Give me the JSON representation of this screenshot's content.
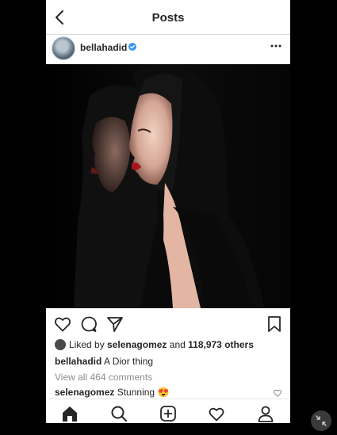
{
  "header": {
    "title": "Posts"
  },
  "post": {
    "username": "bellahadid",
    "likes": {
      "prefix": "Liked by",
      "user": "selenagomez",
      "joiner": "and",
      "count": "118,973 others"
    },
    "caption": {
      "user": "bellahadid",
      "text": "A Dior thing"
    },
    "view_all": "View all 464 comments",
    "comment": {
      "user": "selenagomez",
      "text": "Stunning",
      "emoji": "😍"
    }
  },
  "icons": {
    "back": "chevron-left-icon",
    "verified": "verified-badge-icon",
    "more": "more-options-icon",
    "like": "heart-icon",
    "comment": "comment-icon",
    "share": "share-icon",
    "save": "bookmark-icon",
    "tabs": [
      "home-icon",
      "search-icon",
      "add-icon",
      "activity-heart-icon",
      "profile-icon"
    ]
  },
  "colors": {
    "verified": "#3897f0",
    "text": "#262626",
    "muted": "#8e8e8e"
  }
}
